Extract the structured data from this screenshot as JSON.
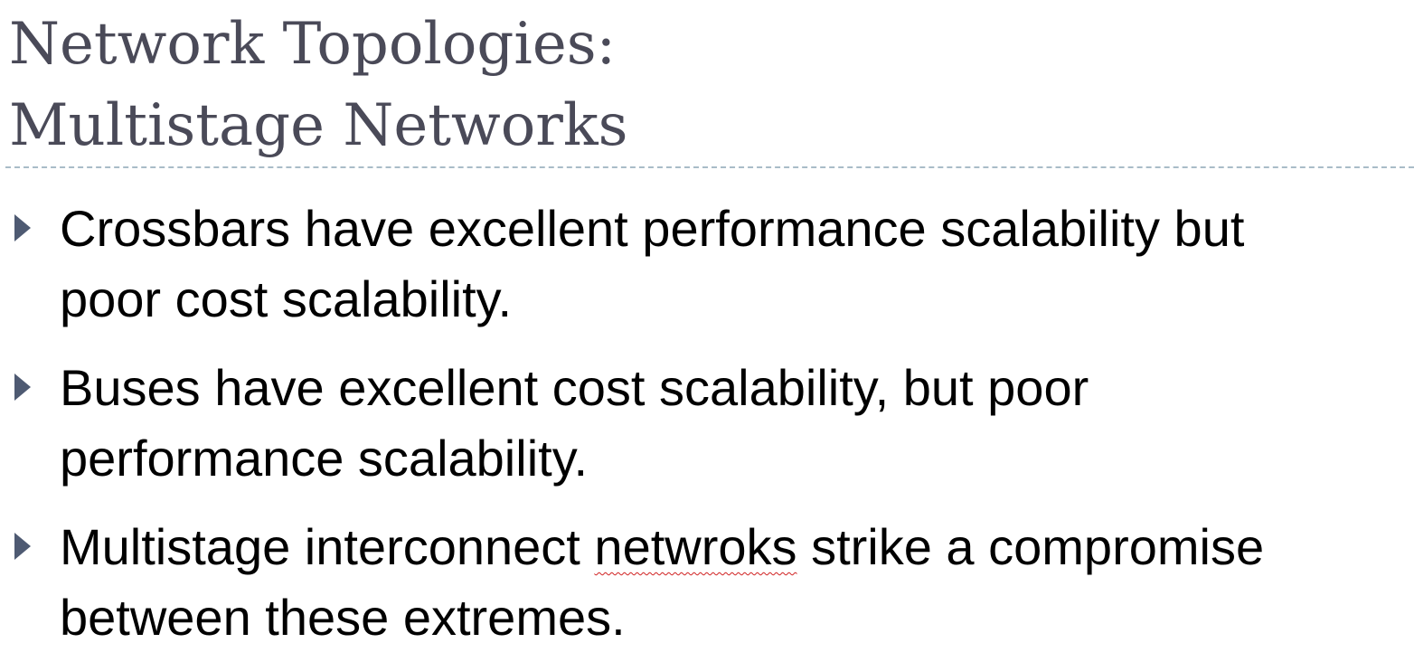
{
  "slide": {
    "title_lines": [
      "Network Topologies:",
      "Multistage Networks"
    ],
    "bullets": [
      {
        "lines": [
          "Crossbars have excellent performance scalability but",
          "poor cost scalability."
        ]
      },
      {
        "lines": [
          "Buses have excellent cost scalability, but poor",
          "performance scalability."
        ]
      },
      {
        "line1_before": "Multistage interconnect ",
        "line1_flagged_word": "netwroks",
        "line1_after": " strike a compromise",
        "line2": "between these extremes."
      }
    ]
  },
  "icons": {
    "bullet_marker": "triangle-right-icon"
  },
  "colors": {
    "title": "#4a4a58",
    "text": "#000000",
    "bullet_marker": "#4e5a72",
    "divider": "#a9bcc8",
    "spellcheck_underline": "#d02020"
  }
}
